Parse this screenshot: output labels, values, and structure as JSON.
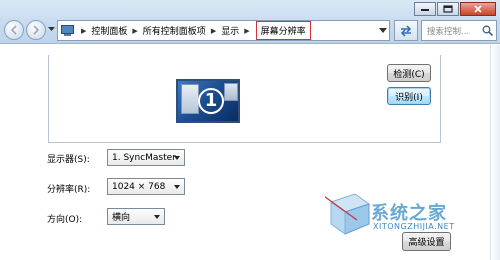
{
  "titlebar": {
    "buttons": [
      "minimize",
      "maximize",
      "close"
    ]
  },
  "address": {
    "crumbs": [
      "控制面板",
      "所有控制面板项",
      "显示"
    ],
    "current": "屏幕分辨率"
  },
  "search": {
    "placeholder": "搜索控制..."
  },
  "preview": {
    "monitor_number": "1",
    "detect_label": "检测(C)",
    "identify_label": "识别(I)"
  },
  "settings": {
    "display_label": "显示器(S):",
    "display_value": "1. SyncMaster",
    "resolution_label": "分辨率(R):",
    "resolution_value": "1024 × 768",
    "orientation_label": "方向(O):",
    "orientation_value": "横向"
  },
  "watermark": {
    "title": "系统之家",
    "subtitle": "XITONGZHIJIA.NET"
  },
  "advanced_label": "高级设置"
}
